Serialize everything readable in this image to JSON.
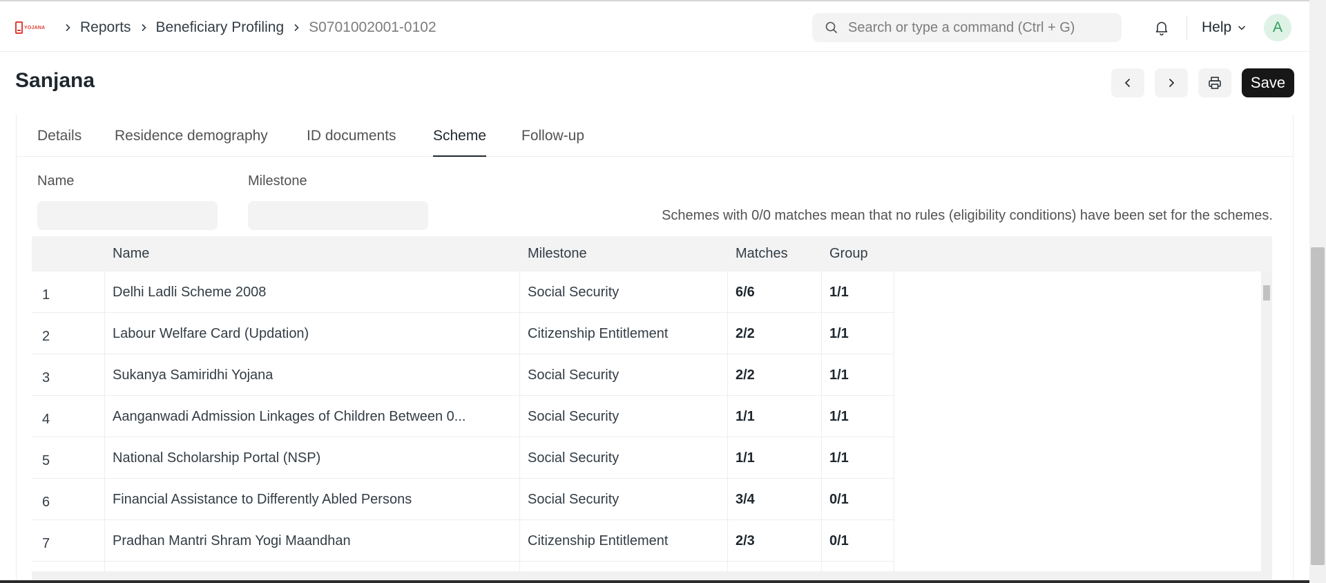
{
  "navbar": {
    "logo_text": "YOJANA",
    "breadcrumbs": [
      "Reports",
      "Beneficiary Profiling",
      "S0701002001-0102"
    ],
    "search_placeholder": "Search or type a command (Ctrl + G)",
    "help_label": "Help",
    "avatar_initial": "A"
  },
  "page": {
    "title": "Sanjana",
    "save_label": "Save"
  },
  "tabs": [
    {
      "label": "Details"
    },
    {
      "label": "Residence demography"
    },
    {
      "label": "ID documents"
    },
    {
      "label": "Scheme",
      "active": true
    },
    {
      "label": "Follow-up"
    }
  ],
  "filters": {
    "name_label": "Name",
    "milestone_label": "Milestone",
    "hint": "Schemes with 0/0 matches mean that no rules (eligibility conditions) have been set for the schemes."
  },
  "grid": {
    "columns": [
      "Name",
      "Milestone",
      "Matches",
      "Group"
    ],
    "rows": [
      {
        "idx": "1",
        "name": "Delhi Ladli Scheme 2008",
        "milestone": "Social Security",
        "matches": "6/6",
        "group": "1/1"
      },
      {
        "idx": "2",
        "name": "Labour Welfare Card (Updation)",
        "milestone": "Citizenship Entitlement",
        "matches": "2/2",
        "group": "1/1"
      },
      {
        "idx": "3",
        "name": "Sukanya Samiridhi Yojana",
        "milestone": "Social Security",
        "matches": "2/2",
        "group": "1/1"
      },
      {
        "idx": "4",
        "name": "Aanganwadi Admission Linkages of Children Between 0...",
        "milestone": "Social Security",
        "matches": "1/1",
        "group": "1/1"
      },
      {
        "idx": "5",
        "name": "National Scholarship Portal (NSP)",
        "milestone": "Social Security",
        "matches": "1/1",
        "group": "1/1"
      },
      {
        "idx": "6",
        "name": "Financial Assistance to Differently Abled Persons",
        "milestone": "Social Security",
        "matches": "3/4",
        "group": "0/1"
      },
      {
        "idx": "7",
        "name": "Pradhan Mantri Shram Yogi Maandhan",
        "milestone": "Citizenship Entitlement",
        "matches": "2/3",
        "group": "0/1"
      }
    ]
  }
}
